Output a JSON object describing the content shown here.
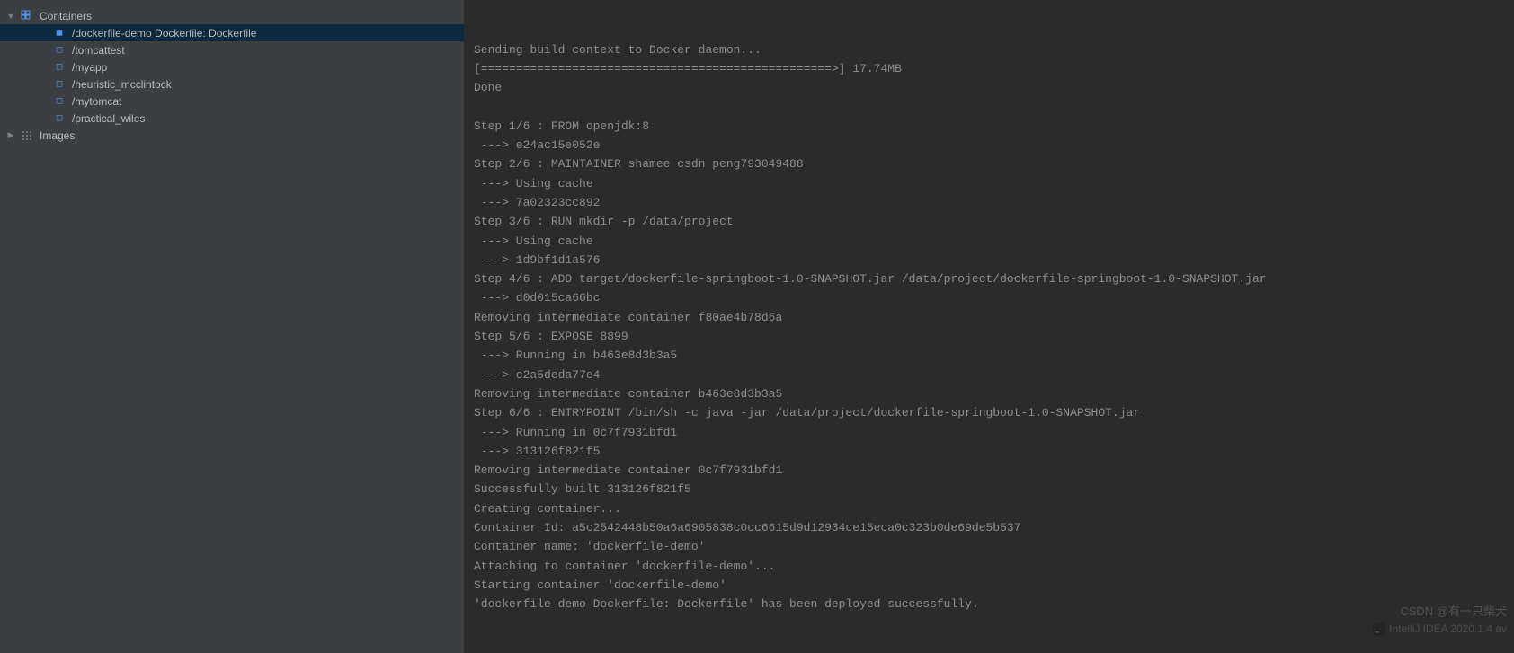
{
  "sidebar": {
    "containers_label": "Containers",
    "images_label": "Images",
    "items": [
      {
        "label": "/dockerfile-demo Dockerfile: Dockerfile",
        "selected": true
      },
      {
        "label": "/tomcattest",
        "selected": false
      },
      {
        "label": "/myapp",
        "selected": false
      },
      {
        "label": "/heuristic_mcclintock",
        "selected": false
      },
      {
        "label": "/mytomcat",
        "selected": false
      },
      {
        "label": "/practical_wiles",
        "selected": false
      }
    ]
  },
  "console": [
    "Sending build context to Docker daemon...",
    "[==================================================>] 17.74MB",
    "Done",
    "",
    "Step 1/6 : FROM openjdk:8",
    " ---> e24ac15e052e",
    "Step 2/6 : MAINTAINER shamee csdn peng793049488",
    " ---> Using cache",
    " ---> 7a02323cc892",
    "Step 3/6 : RUN mkdir -p /data/project",
    " ---> Using cache",
    " ---> 1d9bf1d1a576",
    "Step 4/6 : ADD target/dockerfile-springboot-1.0-SNAPSHOT.jar /data/project/dockerfile-springboot-1.0-SNAPSHOT.jar",
    " ---> d0d015ca66bc",
    "Removing intermediate container f80ae4b78d6a",
    "Step 5/6 : EXPOSE 8899",
    " ---> Running in b463e8d3b3a5",
    " ---> c2a5deda77e4",
    "Removing intermediate container b463e8d3b3a5",
    "Step 6/6 : ENTRYPOINT /bin/sh -c java -jar /data/project/dockerfile-springboot-1.0-SNAPSHOT.jar",
    " ---> Running in 0c7f7931bfd1",
    " ---> 313126f821f5",
    "Removing intermediate container 0c7f7931bfd1",
    "Successfully built 313126f821f5",
    "Creating container...",
    "Container Id: a5c2542448b50a6a6905838c0cc6615d9d12934ce15eca0c323b0de69de5b537",
    "Container name: 'dockerfile-demo'",
    "Attaching to container 'dockerfile-demo'...",
    "Starting container 'dockerfile-demo'",
    "'dockerfile-demo Dockerfile: Dockerfile' has been deployed successfully."
  ],
  "watermark": "CSDN @有一只柴犬",
  "ide_brand": "IntelliJ IDEA 2020.1.4 av"
}
